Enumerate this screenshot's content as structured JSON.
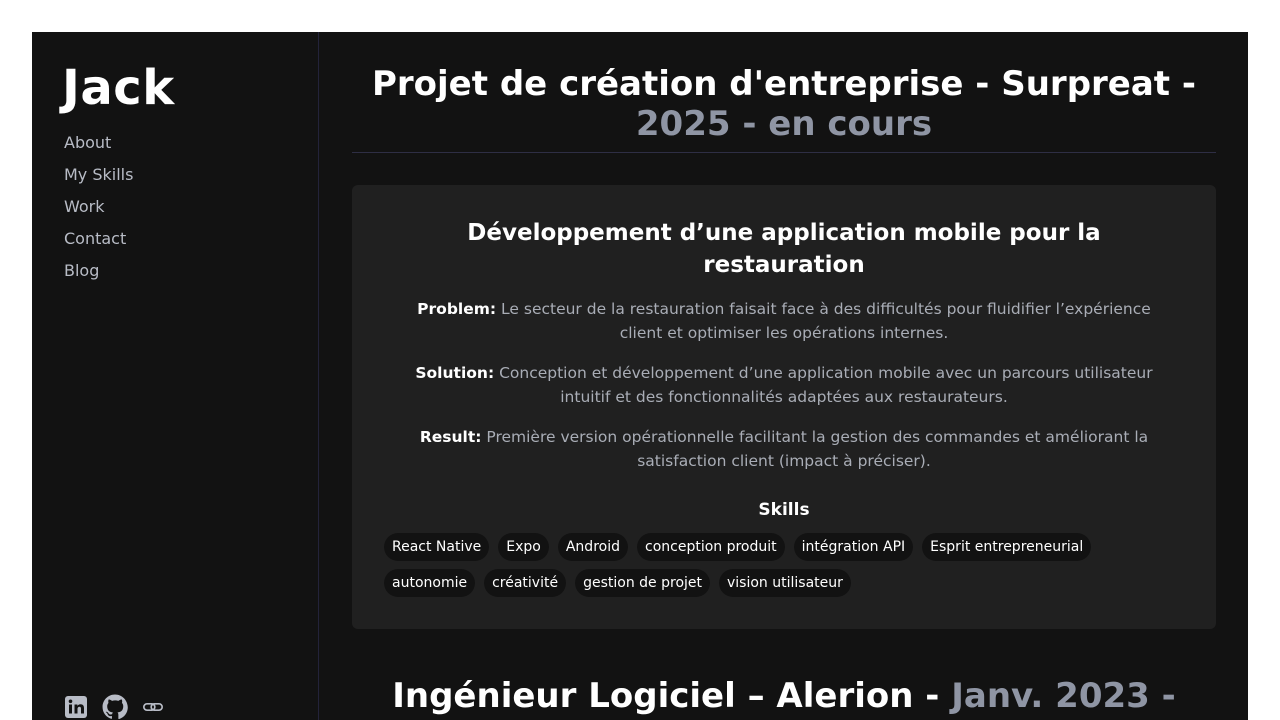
{
  "sidebar": {
    "brand": "Jack",
    "nav": [
      {
        "label": "About"
      },
      {
        "label": "My Skills"
      },
      {
        "label": "Work"
      },
      {
        "label": "Contact"
      },
      {
        "label": "Blog"
      }
    ],
    "socials": [
      {
        "icon": "linkedin-icon"
      },
      {
        "icon": "github-icon"
      },
      {
        "icon": "link-icon"
      }
    ]
  },
  "project": {
    "title": "Projet de création d'entreprise - Surpreat - ",
    "period": "2025 - en cours",
    "card": {
      "heading": "Développement d’une application mobile pour la restauration",
      "problem_label": "Problem:",
      "problem_text": " Le secteur de la restauration faisait face à des difficultés pour fluidifier l’expérience client et optimiser les opérations internes.",
      "solution_label": "Solution:",
      "solution_text": " Conception et développement d’une application mobile avec un parcours utilisateur intuitif et des fonctionnalités adaptées aux restaurateurs.",
      "result_label": "Result:",
      "result_text": " Première version opérationnelle facilitant la gestion des commandes et améliorant la satisfaction client (impact à préciser).",
      "skills_heading": "Skills",
      "skills": [
        "React Native",
        "Expo",
        "Android",
        "conception produit",
        "intégration API",
        "Esprit entrepreneurial",
        "autonomie",
        "créativité",
        "gestion de projet",
        "vision utilisateur"
      ]
    }
  },
  "next_project": {
    "title": "Ingénieur Logiciel – Alerion - ",
    "period": "Janv. 2023 -"
  },
  "colors": {
    "background": "#121212",
    "card": "#202020",
    "muted_text": "#a9adb6",
    "accent_muted": "#8f95a4"
  }
}
